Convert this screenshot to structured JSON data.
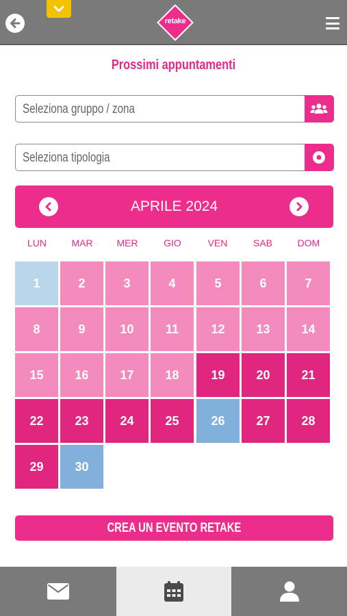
{
  "header": {
    "logo_text": "retake"
  },
  "page_title": "Prossimi appuntamenti",
  "filters": {
    "group_placeholder": "Seleziona gruppo / zona",
    "type_placeholder": "Seleziona tipologia"
  },
  "calendar": {
    "month_label": "APRILE 2024",
    "weekdays": [
      "LUN",
      "MAR",
      "MER",
      "GIO",
      "VEN",
      "SAB",
      "DOM"
    ],
    "days": [
      "1",
      "2",
      "3",
      "4",
      "5",
      "6",
      "7",
      "8",
      "9",
      "10",
      "11",
      "12",
      "13",
      "14",
      "15",
      "16",
      "17",
      "18",
      "19",
      "20",
      "21",
      "22",
      "23",
      "24",
      "25",
      "26",
      "27",
      "28",
      "29",
      "30"
    ],
    "colors": {
      "past": "#f48bbd",
      "future": "#e0267f",
      "first_day": "#b9d6ea",
      "highlight": "#82b0dd"
    }
  },
  "create_button_label": "CREA UN EVENTO RETAKE",
  "bottom_nav": {
    "items": [
      "mail-icon",
      "calendar-icon",
      "user-icon"
    ],
    "active": "calendar-icon"
  },
  "colors": {
    "brand_pink": "#ec2d8c",
    "header_gray": "#7a7a7a",
    "accent_yellow": "#f2c100"
  }
}
